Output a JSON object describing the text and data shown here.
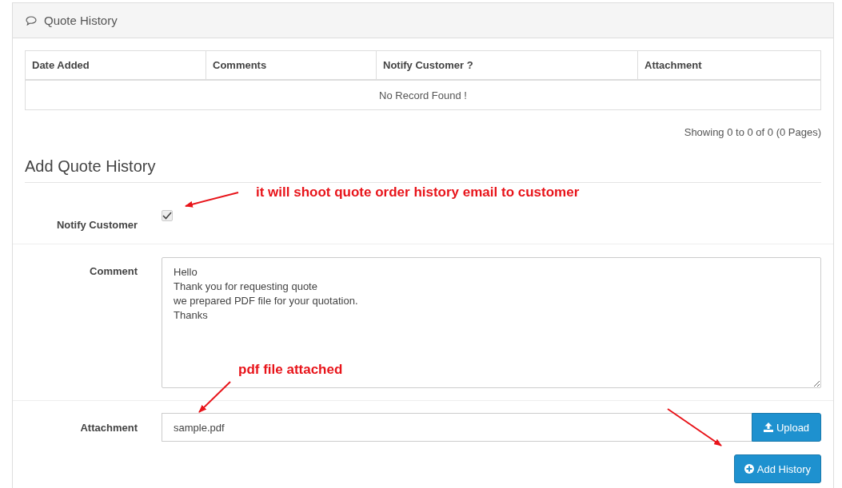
{
  "panel": {
    "title": "Quote History"
  },
  "table": {
    "columns": [
      "Date Added",
      "Comments",
      "Notify Customer ?",
      "Attachment"
    ],
    "empty_message": "No Record Found !"
  },
  "pagination": "Showing 0 to 0 of 0 (0 Pages)",
  "form": {
    "title": "Add Quote History",
    "notify": {
      "label": "Notify Customer",
      "checked": true
    },
    "comment": {
      "label": "Comment",
      "value": "Hello\nThank you for requesting quote\nwe prepared PDF file for your quotation.\nThanks"
    },
    "attachment": {
      "label": "Attachment",
      "value": "sample.pdf",
      "button": "Upload"
    },
    "submit": "Add History"
  },
  "annotations": [
    {
      "text": "it will shoot quote order history email to customer"
    },
    {
      "text": "pdf file attached"
    }
  ]
}
